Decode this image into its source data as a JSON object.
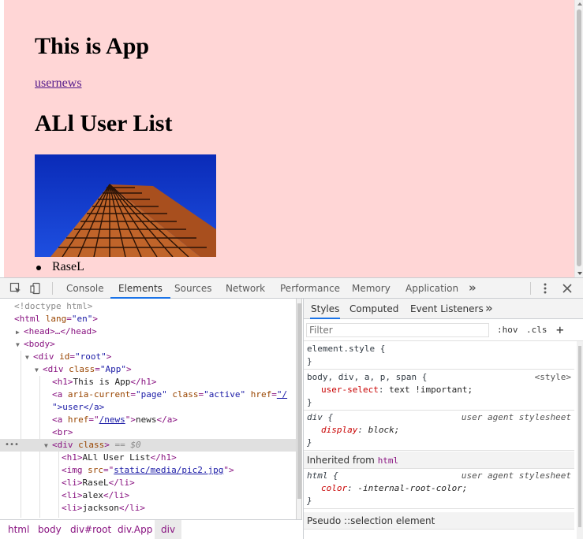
{
  "page": {
    "title": "This is App",
    "nav_link": "usernews",
    "list_title": "ALl User List",
    "users": [
      "RaseL"
    ]
  },
  "devtools": {
    "tabs": [
      "Console",
      "Elements",
      "Sources",
      "Network",
      "Performance",
      "Memory",
      "Application"
    ],
    "more": "»",
    "dom": {
      "doctype": "<!doctype html>",
      "html_open": "<html",
      "lang_attr": "lang",
      "lang_val": "\"en\"",
      "head": "<head>…</head>",
      "body": "<body>",
      "div_root": "<div",
      "id_attr": "id",
      "id_val": "\"root\"",
      "div_app": "<div",
      "class_attr": "class",
      "class_app": "\"App\"",
      "h1": "This is App",
      "a_attr1": "aria-current",
      "a_val1": "\"page\"",
      "a_attr2": "class",
      "a_val2": "\"active\"",
      "a_attr3": "href",
      "a_val3_part": "\"/",
      "a_cont": "\">user</a>",
      "a2_href_attr": "href",
      "a2_href_val": "/news",
      "a2_text": "news",
      "br": "<br>",
      "sel_div": "<div",
      "sel_class": "class",
      "sel_marker": "== $0",
      "h1_2": "ALl User List",
      "img_src_attr": "src",
      "img_src_val": "static/media/pic2.jpg",
      "li_items": [
        "RaseL",
        "alex",
        "jackson"
      ]
    },
    "breadcrumbs": [
      "html",
      "body",
      "div#root",
      "div.App",
      "div"
    ],
    "styles": {
      "tabs": [
        "Styles",
        "Computed",
        "Event Listeners"
      ],
      "filter_placeholder": "Filter",
      "hov": ":hov",
      "cls": ".cls",
      "add": "+",
      "element_style": "element.style {",
      "close": "}",
      "rule1_selector": "body, div, a, p, span {",
      "rule1_source": "<style>",
      "rule1_prop": "user-select",
      "rule1_val": "text !important;",
      "rule2_selector": "div {",
      "rule2_source": "user agent stylesheet",
      "rule2_prop": "display",
      "rule2_val": "block;",
      "inherited_label": "Inherited from",
      "inherited_tag": "html",
      "rule3_selector": "html {",
      "rule3_source": "user agent stylesheet",
      "rule3_prop": "color",
      "rule3_val": "-internal-root-color;",
      "pseudo_label": "Pseudo ::selection element"
    }
  },
  "colors": {
    "page_bg": "#ffd6d6",
    "active_tab": "#1a73e8",
    "link": "#551a8b"
  }
}
